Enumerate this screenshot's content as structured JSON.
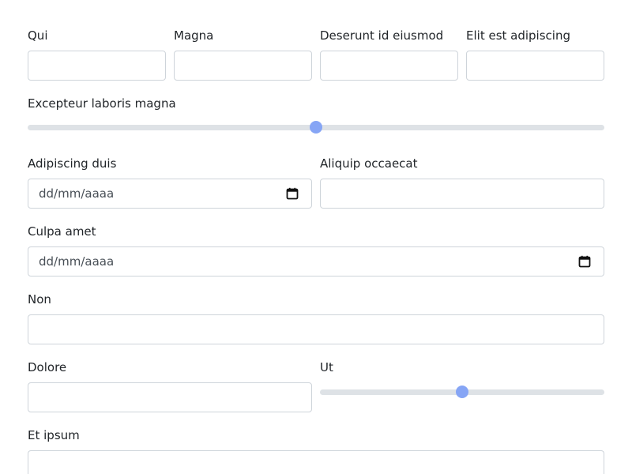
{
  "form": {
    "row1": [
      {
        "label": "Qui",
        "value": ""
      },
      {
        "label": "Magna",
        "value": ""
      },
      {
        "label": "Deserunt id eiusmod",
        "value": ""
      },
      {
        "label": "Elit est adipiscing",
        "value": ""
      }
    ],
    "range1": {
      "label": "Excepteur laboris magna",
      "value_fraction": 0.5
    },
    "row2": [
      {
        "label": "Adipiscing duis",
        "placeholder": "dd/mm/aaaa",
        "icon": "calendar-icon"
      },
      {
        "label": "Aliquip occaecat",
        "value": ""
      }
    ],
    "culpa": {
      "label": "Culpa amet",
      "placeholder": "dd/mm/aaaa",
      "icon": "calendar-icon"
    },
    "non": {
      "label": "Non",
      "value": ""
    },
    "row3": [
      {
        "label": "Dolore",
        "value": ""
      },
      {
        "label": "Ut",
        "value_fraction": 0.5
      }
    ],
    "et_ipsum": {
      "label": "Et ipsum",
      "value": ""
    }
  },
  "colors": {
    "accent": "#86a5f5",
    "track": "#dee2e6",
    "border": "#ced4da"
  }
}
